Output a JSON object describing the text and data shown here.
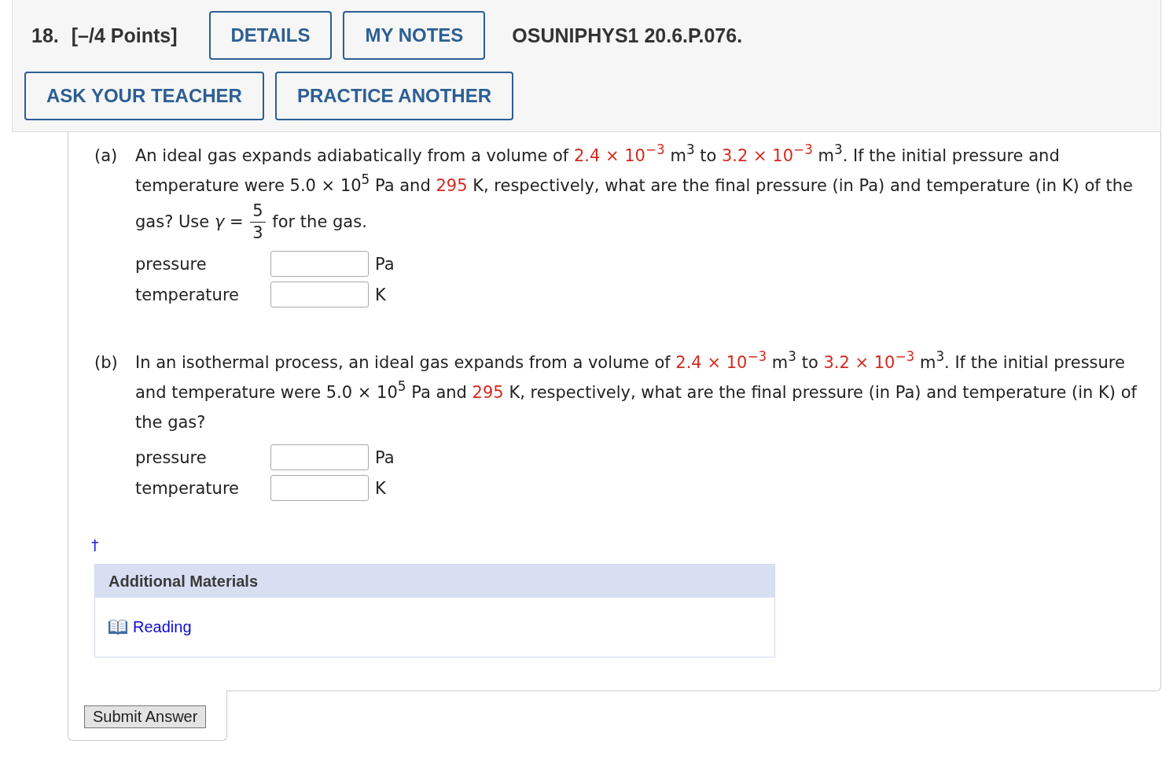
{
  "header": {
    "number": "18.",
    "points": "[–/4 Points]",
    "buttons": [
      "DETAILS",
      "MY NOTES"
    ],
    "code": "OSUNIPHYS1 20.6.P.076.",
    "actions": [
      "ASK YOUR TEACHER",
      "PRACTICE ANOTHER"
    ]
  },
  "parts": [
    {
      "label": "(a)",
      "text": [
        {
          "kind": "plain",
          "text": "An ideal gas expands adiabatically from a volume of "
        },
        {
          "kind": "value",
          "text": "2.4 × 10$^{−3}$"
        },
        {
          "kind": "plain",
          "text": " m$^{3}$ to "
        },
        {
          "kind": "value",
          "text": "3.2 × 10$^{−3}$"
        },
        {
          "kind": "plain",
          "text": " m$^{3}$. If the initial pressure and temperature were 5.0 × 10$^{5}$ Pa and "
        },
        {
          "kind": "value",
          "text": "295"
        },
        {
          "kind": "plain",
          "text": " K, respectively, what are the final pressure (in Pa) and temperature (in K) of the gas? Use *γ* = "
        },
        {
          "kind": "fraction",
          "numerator": "5",
          "denominator": "3"
        },
        {
          "kind": "plain",
          "text": " for the gas."
        }
      ],
      "answers": [
        {
          "label": "pressure",
          "unit": "Pa"
        },
        {
          "label": "temperature",
          "unit": "K"
        }
      ]
    },
    {
      "label": "(b)",
      "text": [
        {
          "kind": "plain",
          "text": "In an isothermal process, an ideal gas expands from a volume of "
        },
        {
          "kind": "value",
          "text": "2.4 × 10$^{−3}$"
        },
        {
          "kind": "plain",
          "text": " m$^{3}$ to "
        },
        {
          "kind": "value",
          "text": "3.2 × 10$^{−3}$"
        },
        {
          "kind": "plain",
          "text": " m$^{3}$. If the initial pressure and temperature were 5.0 × 10$^{5}$ Pa and "
        },
        {
          "kind": "value",
          "text": "295"
        },
        {
          "kind": "plain",
          "text": " K, respectively, what are the final pressure (in Pa) and temperature (in K) of the gas?"
        }
      ],
      "answers": [
        {
          "label": "pressure",
          "unit": "Pa"
        },
        {
          "label": "temperature",
          "unit": "K"
        }
      ]
    }
  ],
  "footnote": "†",
  "additional_materials": {
    "title": "Additional Materials",
    "links": [
      "Reading"
    ]
  },
  "submit": "Submit Answer"
}
